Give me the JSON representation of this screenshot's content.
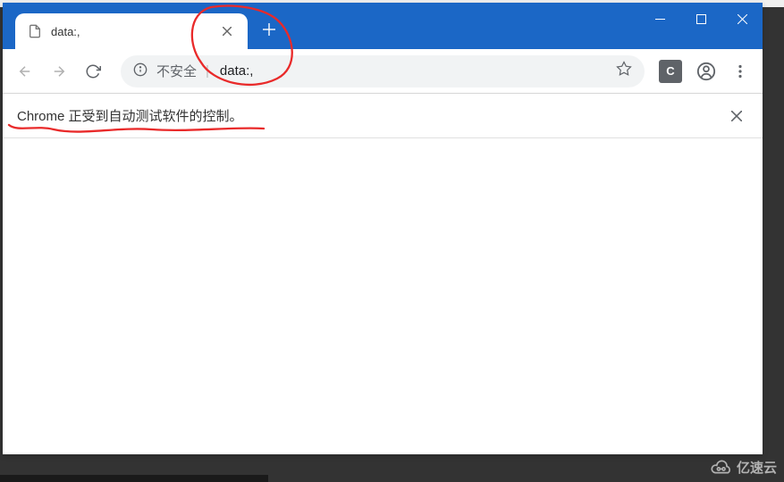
{
  "window": {
    "title_bar_color": "#1b67c6"
  },
  "tab": {
    "title": "data:,"
  },
  "omnibox": {
    "security_label": "不安全",
    "url": "data:,"
  },
  "extension": {
    "badge_letter": "C"
  },
  "infobar": {
    "message": "Chrome 正受到自动测试软件的控制。"
  },
  "watermark": {
    "text": "亿速云"
  },
  "annotation": {
    "stroke_color": "#e92a2a"
  }
}
